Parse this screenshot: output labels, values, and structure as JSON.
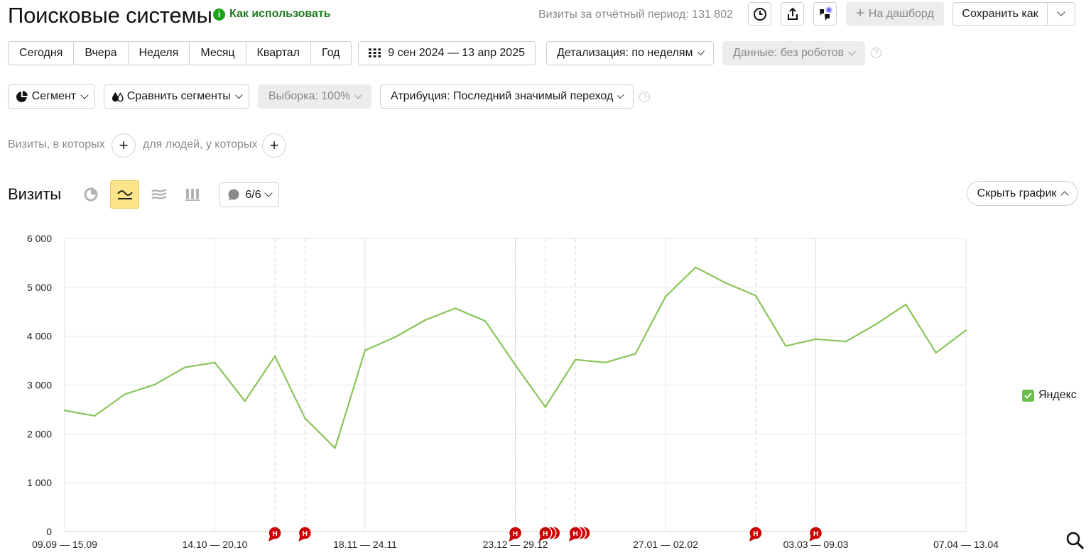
{
  "header": {
    "title": "Поисковые системы",
    "how_to_use": "Как использовать",
    "visits_summary": "Визиты за отчётный период: 131 802",
    "to_dashboard": "На дашборд",
    "save_as": "Сохранить как"
  },
  "periods": [
    "Сегодня",
    "Вчера",
    "Неделя",
    "Месяц",
    "Квартал",
    "Год"
  ],
  "date_range": "9 сен 2024 — 13 апр 2025",
  "detail": "Детализация: по неделям",
  "data_filter": "Данные: без роботов",
  "segment": "Сегмент",
  "compare_segments": "Сравнить сегменты",
  "sample": "Выборка: 100%",
  "attribution": "Атрибуция: Последний значимый переход",
  "filters": {
    "visits_where": "Визиты, в которых",
    "people_where": "для людей, у которых"
  },
  "chart_header": {
    "title": "Визиты",
    "notes_count": "6/6",
    "hide_chart": "Скрыть график"
  },
  "colors": {
    "line": "#8ac45a",
    "annotation": "#cc0000",
    "active_tool": "#fde38a"
  },
  "chart_data": {
    "type": "line",
    "ylim": [
      0,
      6000
    ],
    "y_ticks": [
      "0",
      "1 000",
      "2 000",
      "3 000",
      "4 000",
      "5 000",
      "6 000"
    ],
    "x_tick_labels": [
      {
        "index": 0,
        "label": "09.09 — 15.09"
      },
      {
        "index": 5,
        "label": "14.10 — 20.10"
      },
      {
        "index": 10,
        "label": "18.11 — 24.11"
      },
      {
        "index": 15,
        "label": "23.12 — 29.12"
      },
      {
        "index": 20,
        "label": "27.01 — 02.02"
      },
      {
        "index": 25,
        "label": "03.03 — 09.03"
      },
      {
        "index": 30,
        "label": "07.04 — 13.04"
      }
    ],
    "series": [
      {
        "name": "Яндекс",
        "values": [
          2480,
          2370,
          2810,
          3010,
          3360,
          3460,
          2670,
          3590,
          2320,
          1710,
          3710,
          3980,
          4330,
          4570,
          4310,
          3410,
          2550,
          3520,
          3460,
          3640,
          4810,
          5410,
          5090,
          4830,
          3800,
          3940,
          3890,
          4240,
          4650,
          3660,
          4120
        ]
      }
    ],
    "annotations": [
      {
        "index": 7,
        "count": 1,
        "label": "Н"
      },
      {
        "index": 8,
        "count": 1,
        "label": "Н"
      },
      {
        "index": 15,
        "count": 1,
        "label": "Н"
      },
      {
        "index": 16,
        "count": 3,
        "label": "Н"
      },
      {
        "index": 17,
        "count": 3,
        "label": "Н"
      },
      {
        "index": 23,
        "count": 1,
        "label": "Н"
      },
      {
        "index": 25,
        "count": 1,
        "label": "Н"
      }
    ],
    "grid": true,
    "legend_position": "right"
  }
}
